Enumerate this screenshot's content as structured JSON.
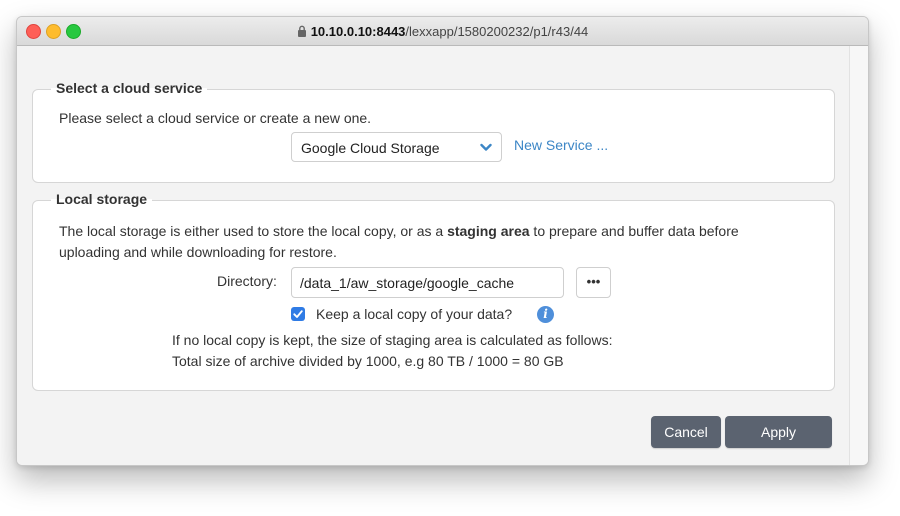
{
  "browser": {
    "url_host": "10.10.0.10:8443",
    "url_path": "/lexxapp/1580200232/p1/r43/44"
  },
  "cloud_section": {
    "legend": "Select a cloud service",
    "description": "Please select a cloud service or create a new one.",
    "selected_service": "Google Cloud Storage",
    "new_service_link": "New Service ..."
  },
  "local_section": {
    "legend": "Local storage",
    "description_part1": "The local storage is either used to store the local copy, or as a ",
    "description_bold": "staging area",
    "description_part2": " to prepare and buffer data before",
    "description_line2": "uploading and while downloading for restore.",
    "directory_label": "Directory:",
    "directory_value": "/data_1/aw_storage/google_cache",
    "browse_label": "•••",
    "keep_copy_label": "Keep a local copy of your data?",
    "keep_copy_checked": true,
    "note_line1": "If no local copy is kept, the size of staging area is calculated as follows:",
    "note_line2": "Total size of archive divided by 1000, e.g 80 TB / 1000 = 80 GB"
  },
  "footer": {
    "cancel_label": "Cancel",
    "apply_label": "Apply"
  },
  "icons": {
    "lock": "lock-icon",
    "chevron": "chevron-down-icon",
    "check": "check-icon",
    "info": "info-icon"
  },
  "colors": {
    "accent": "#3c86c6",
    "checkbox": "#2f7be5",
    "button": "#5b6370"
  }
}
